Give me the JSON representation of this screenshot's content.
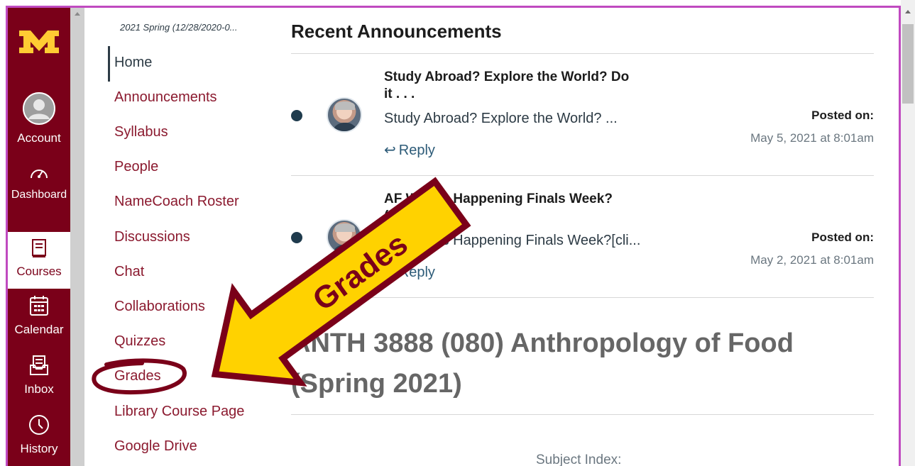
{
  "global_nav": {
    "logo_icon": "university-m-logo-icon",
    "items": [
      {
        "label": "Account",
        "icon": "account-avatar-icon"
      },
      {
        "label": "Dashboard",
        "icon": "dashboard-gauge-icon"
      },
      {
        "label": "Courses",
        "icon": "courses-book-icon",
        "active": true
      },
      {
        "label": "Calendar",
        "icon": "calendar-icon"
      },
      {
        "label": "Inbox",
        "icon": "inbox-icon"
      },
      {
        "label": "History",
        "icon": "history-clock-icon"
      }
    ]
  },
  "course_nav": {
    "term": "2021 Spring (12/28/2020-0...",
    "items": [
      {
        "label": "Home",
        "active": true
      },
      {
        "label": "Announcements"
      },
      {
        "label": "Syllabus"
      },
      {
        "label": "People"
      },
      {
        "label": "NameCoach Roster"
      },
      {
        "label": "Discussions"
      },
      {
        "label": "Chat"
      },
      {
        "label": "Collaborations"
      },
      {
        "label": "Quizzes"
      },
      {
        "label": "Grades"
      },
      {
        "label": "Library Course Page"
      },
      {
        "label": "Google Drive"
      }
    ]
  },
  "main": {
    "heading": "Recent Announcements",
    "announcements": [
      {
        "title": "Study Abroad?  Explore the World? Do it . . .",
        "snippet": "Study Abroad?  Explore the World? ...",
        "reply": "Reply",
        "posted_label": "Posted on:",
        "posted_date": "May 5, 2021 at 8:01am"
      },
      {
        "title": "AF What's Happening Finals Week? (M...",
        "snippet": "AF What's Happening Finals Week?[cli...",
        "reply": "Reply",
        "posted_label": "Posted on:",
        "posted_date": "May 2, 2021 at 8:01am"
      }
    ],
    "course_title": "ANTH 3888 (080) Anthropology of Food (Spring 2021)",
    "subject_index": "Subject Index:"
  },
  "annotation": {
    "arrow_label": "Grades",
    "arrow_fill": "#ffd200",
    "arrow_stroke": "#7a0019"
  },
  "colors": {
    "brand": "#7a0019",
    "window_border": "#c04ac0",
    "link": "#8b1a2f"
  }
}
